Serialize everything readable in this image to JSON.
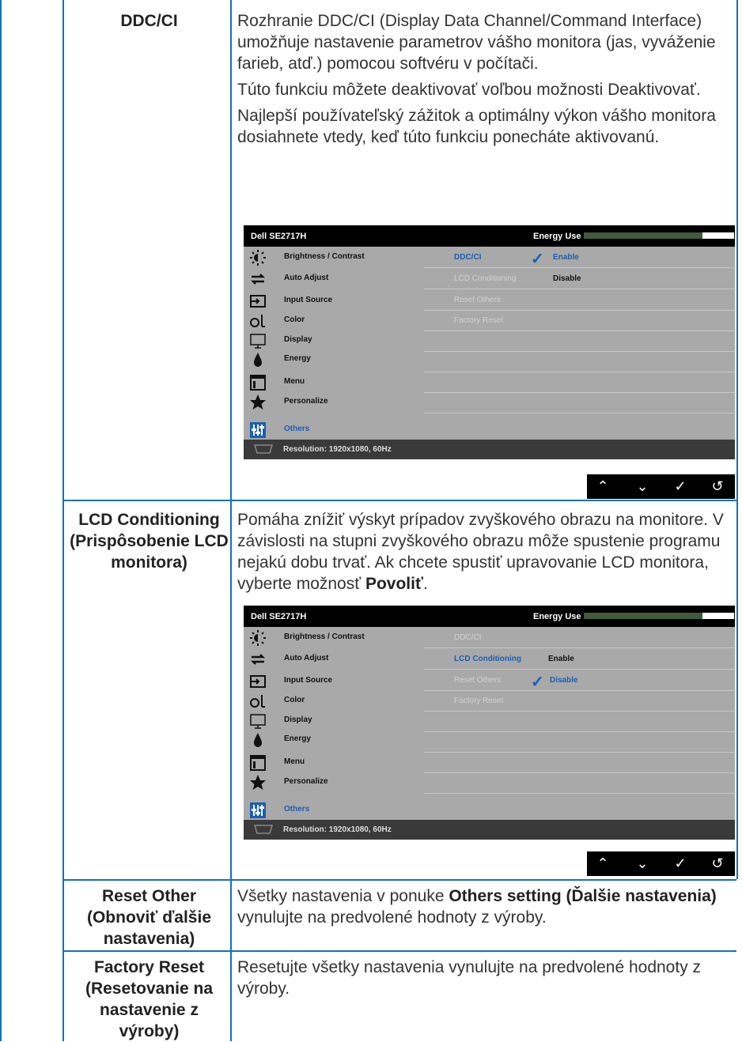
{
  "rows": [
    {
      "label": "DDC/CI",
      "paragraphs": [
        "Rozhranie DDC/CI (Display Data Channel/Command Interface) umožňuje nastavenie parametrov vášho monitora (jas, vyváženie farieb, atď.) pomocou softvéru v počítači.",
        "Túto funkciu môžete deaktivovať voľbou možnosti Deaktivovať.",
        "Najlepší používateľský zážitok a optimálny výkon vášho monitora dosiahnete vtedy, keď túto funkciu ponecháte aktivovanú."
      ]
    },
    {
      "label": "LCD Conditioning (Prispôsobenie LCD monitora)",
      "text_before_bold": "Pomáha znížiť výskyt prípadov zvyškového obrazu na monitore. V závislosti na stupni zvyškového obrazu môže spustenie programu nejakú dobu trvať. Ak chcete spustiť upravovanie LCD monitora, vyberte možnosť ",
      "bold": "Povoliť",
      "text_after_bold": "."
    },
    {
      "label": "Reset Other (Obnoviť ďalšie nastavenia)",
      "text_before_bold": "Všetky nastavenia v ponuke ",
      "bold": "Others setting (Ďalšie nastavenia)",
      "text_after_bold": " vynulujte na predvolené hodnoty z výroby."
    },
    {
      "label": "Factory Reset (Resetovanie na nastavenie z výroby)",
      "text": "Resetujte všetky nastavenia vynulujte na predvolené hodnoty z výroby."
    }
  ],
  "osd": {
    "model": "Dell SE2717H",
    "energy_label": "Energy Use",
    "energy_level_fraction": 0.79,
    "menu_items": [
      {
        "label": "Brightness / Contrast",
        "icon": "brightness-icon"
      },
      {
        "label": "Auto Adjust",
        "icon": "auto-adjust-icon"
      },
      {
        "label": "Input Source",
        "icon": "input-source-icon"
      },
      {
        "label": "Color",
        "icon": "color-icon"
      },
      {
        "label": "Display",
        "icon": "display-icon"
      },
      {
        "label": "Energy",
        "icon": "energy-icon"
      },
      {
        "label": "Menu",
        "icon": "menu-icon"
      },
      {
        "label": "Personalize",
        "icon": "star-icon"
      },
      {
        "label": "Others",
        "icon": "others-icon"
      }
    ],
    "submenu": [
      "DDC/CI",
      "LCD Conditioning",
      "Reset Others",
      "Factory Reset"
    ],
    "enable": "Enable",
    "disable": "Disable",
    "resolution": "Resolution: 1920x1080, 60Hz",
    "nav": [
      "up-icon",
      "down-icon",
      "check-icon",
      "back-icon"
    ]
  },
  "colors": {
    "rule": "#0f73b9",
    "osd_gray": "#a9a9a9",
    "osd_blue": "#1a5fb4",
    "energy_bar": "#3f5b3a"
  }
}
